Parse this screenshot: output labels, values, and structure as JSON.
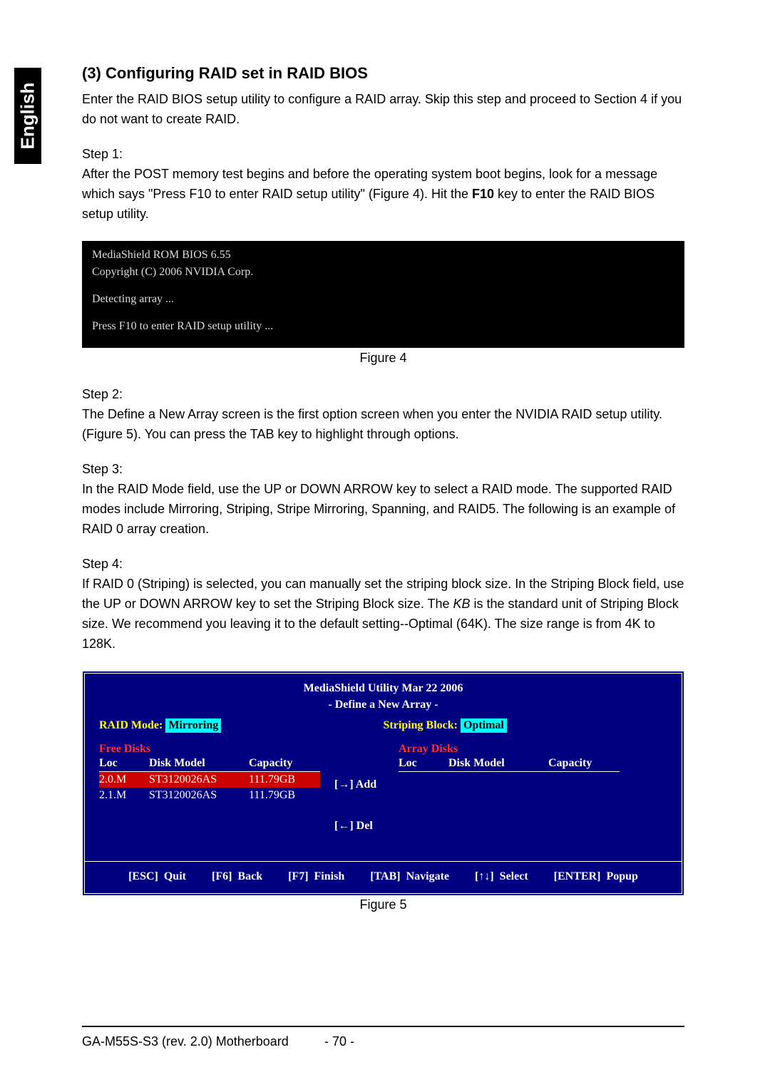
{
  "tab_label": "English",
  "section_title": "(3)  Configuring RAID set in RAID BIOS",
  "intro": "Enter the RAID BIOS setup utility to configure a RAID array. Skip this step and proceed to Section 4 if you do not want to create RAID.",
  "step1": {
    "label": "Step 1:",
    "text_a": "After the POST memory test begins and before the operating system boot begins, look for a message which says \"Press F10 to enter RAID setup utility\" (Figure 4). Hit the ",
    "key": "F10",
    "text_b": " key to enter the RAID BIOS setup utility."
  },
  "bios_console": {
    "line1": "MediaShield ROM BIOS 6.55",
    "line2": "Copyright (C) 2006 NVIDIA Corp.",
    "line3": "Detecting array ...",
    "line4": "Press F10 to enter RAID setup utility ..."
  },
  "figure4_caption": "Figure 4",
  "step2": {
    "label": "Step 2:",
    "text": "The Define a New Array screen is the first option screen when you enter the NVIDIA RAID setup utility. (Figure 5). You can press the TAB key to highlight through options."
  },
  "step3": {
    "label": "Step 3:",
    "text": "In the RAID Mode field, use the UP or DOWN ARROW key to select a RAID mode. The supported RAID modes include Mirroring, Striping, Stripe Mirroring, Spanning, and RAID5. The following is an example of RAID 0 array creation."
  },
  "step4": {
    "label": "Step 4:",
    "text_a": "If RAID 0 (Striping) is selected, you can manually set the striping block size. In the Striping Block field, use the UP or DOWN ARROW key to set the Striping Block size. The ",
    "italic": "KB",
    "text_b": " is the standard unit of Striping Block size.  We recommend you leaving it to the default setting--Optimal (64K). The size range is from 4K to 128K."
  },
  "raid_util": {
    "header1": "MediaShield Utility  Mar  22 2006",
    "header2": "- Define a New Array -",
    "raid_mode_label": "RAID Mode:",
    "raid_mode_value": "Mirroring",
    "striping_label": "Striping Block:",
    "striping_value": "Optimal",
    "free_disks_label": "Free Disks",
    "array_disks_label": "Array Disks",
    "col_loc": "Loc",
    "col_model": "Disk Model",
    "col_cap": "Capacity",
    "free_disks": [
      {
        "loc": "2.0.M",
        "model": "ST3120026AS",
        "cap": "111.79GB",
        "selected": true
      },
      {
        "loc": "2.1.M",
        "model": "ST3120026AS",
        "cap": "111.79GB",
        "selected": false
      }
    ],
    "add_label": "[→] Add",
    "del_label": "[←] Del",
    "footer": {
      "quit": "[ESC] Quit",
      "back": "[F6] Back",
      "finish": "[F7] Finish",
      "navigate": "[TAB] Navigate",
      "select": "[↑↓] Select",
      "popup": "[ENTER] Popup"
    }
  },
  "figure5_caption": "Figure 5",
  "footer": {
    "model": "GA-M55S-S3 (rev. 2.0) Motherboard",
    "page": "- 70 -"
  }
}
